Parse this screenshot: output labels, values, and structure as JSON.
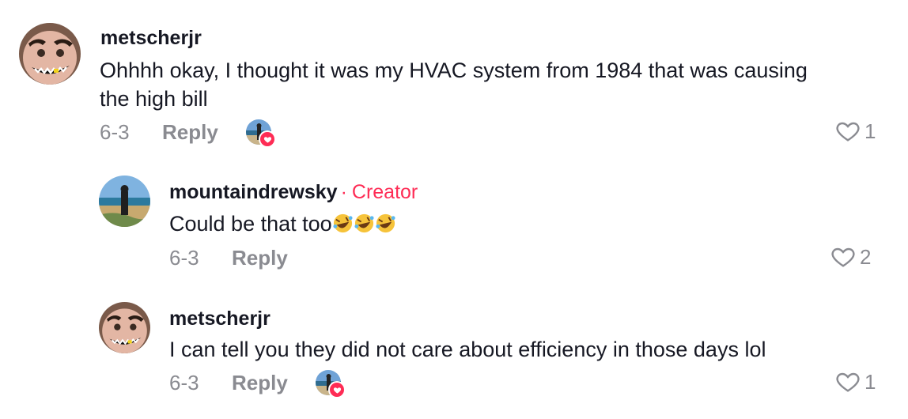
{
  "comments": [
    {
      "username": "metscherjr",
      "text_line1": "Ohhhh okay, I thought it was my HVAC system from 1984 that was causing",
      "text_line2": "the high bill",
      "date": "6-3",
      "reply_label": "Reply",
      "likes": "1",
      "liked_by_creator": true
    },
    {
      "username": "mountaindrewsky",
      "separator": "·",
      "creator_label": "Creator",
      "text": "Could be that too",
      "emojis": [
        "rolling-on-floor-laughing",
        "rolling-on-floor-laughing",
        "rolling-on-floor-laughing"
      ],
      "date": "6-3",
      "reply_label": "Reply",
      "likes": "2",
      "liked_by_creator": false
    },
    {
      "username": "metscherjr",
      "text": "I can tell you they did not care about efficiency in those days lol",
      "date": "6-3",
      "reply_label": "Reply",
      "likes": "1",
      "liked_by_creator": true
    }
  ],
  "colors": {
    "creator": "#fe2c55",
    "muted": "#8a8b91",
    "text": "#161823"
  },
  "icons": {
    "like": "heart-outline-icon",
    "liked_badge": "heart-filled-icon"
  }
}
